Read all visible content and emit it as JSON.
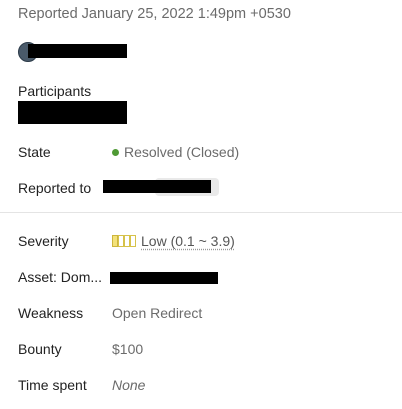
{
  "header": {
    "reported_text": "Reported January 25, 2022 1:49pm +0530"
  },
  "participants_label": "Participants",
  "fields": {
    "state": {
      "label": "State",
      "value": "Resolved (Closed)",
      "status_color": "#4f9a35"
    },
    "reported_to": {
      "label": "Reported to"
    },
    "severity": {
      "label": "Severity",
      "value": "Low (0.1 ~ 3.9)",
      "level_filled": 1,
      "level_total": 4
    },
    "asset": {
      "label": "Asset: Dom..."
    },
    "weakness": {
      "label": "Weakness",
      "value": "Open Redirect"
    },
    "bounty": {
      "label": "Bounty",
      "value": "$100"
    },
    "time_spent": {
      "label": "Time spent",
      "value": "None"
    }
  },
  "icons": {
    "status": "status-dot-icon",
    "severity": "severity-bars-icon"
  }
}
